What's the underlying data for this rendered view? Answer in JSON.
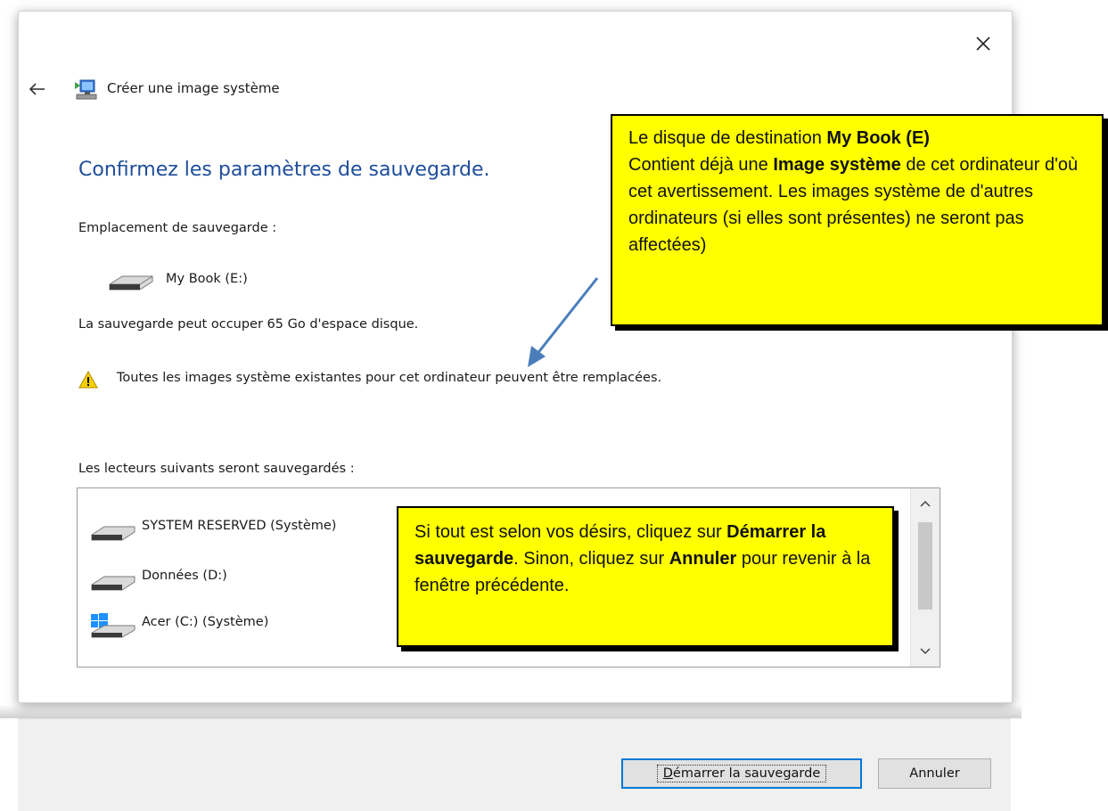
{
  "window": {
    "title": "Créer une image système",
    "heading": "Confirmez les paramètres de sauvegarde.",
    "close_icon": "close-icon",
    "back_icon": "back-arrow-icon"
  },
  "backup": {
    "location_label": "Emplacement de sauvegarde :",
    "location_value": "My Book (E:)",
    "space_text": "La sauvegarde peut occuper 65 Go d'espace disque.",
    "warning_text": "Toutes les images système existantes pour cet ordinateur peuvent être remplacées.",
    "drives_label": "Les lecteurs suivants seront sauvegardés :",
    "drives": [
      {
        "label": "SYSTEM RESERVED (Système)",
        "icon": "hard-drive-icon"
      },
      {
        "label": "Données (D:)",
        "icon": "hard-drive-icon"
      },
      {
        "label": "Acer (C:) (Système)",
        "icon": "windows-drive-icon"
      }
    ]
  },
  "callouts": {
    "top": {
      "p1": "Le disque de destination ",
      "b1": "My Book (E)",
      "p2": "Contient déjà une ",
      "b2": "Image système",
      "p3": " de cet ordinateur d'où cet avertissement.  Les images système de d'autres ordinateurs (si elles sont présentes) ne seront pas affectées)"
    },
    "bottom": {
      "p1": "Si tout est selon vos désirs, cliquez sur ",
      "b1": "Démarrer la sauvegarde",
      "p2": ".  Sinon, cliquez sur ",
      "b2": "Annuler",
      "p3": " pour revenir à la fenêtre précédente."
    }
  },
  "buttons": {
    "start_first": "D",
    "start_rest": "émarrer la sauvegarde",
    "cancel": "Annuler"
  },
  "colors": {
    "heading": "#1e4e9a",
    "callout_bg": "#ffff00",
    "arrow": "#4a7ebb",
    "primary_border": "#0078d7"
  }
}
